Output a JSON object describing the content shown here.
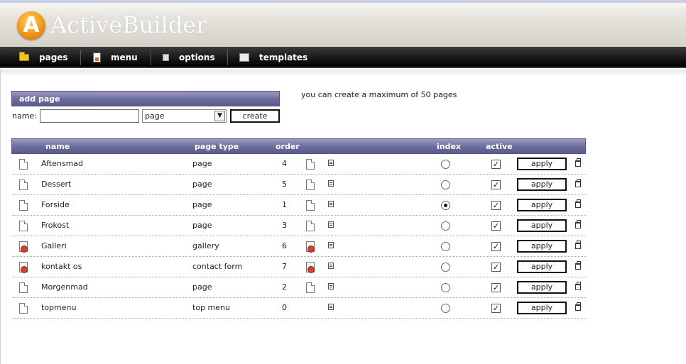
{
  "app": {
    "logo_letter": "A",
    "title": "ActiveBuilder"
  },
  "nav": [
    {
      "label": "pages",
      "icon": "folder-icon"
    },
    {
      "label": "menu",
      "icon": "menu-icon"
    },
    {
      "label": "options",
      "icon": "options-icon"
    },
    {
      "label": "templates",
      "icon": "templates-icon"
    }
  ],
  "add_page": {
    "title": "add page",
    "info": "you can create a maximum of 50 pages",
    "name_label": "name:",
    "name_value": "",
    "type_selected": "page",
    "create_label": "create"
  },
  "table": {
    "headers": {
      "name": "name",
      "page_type": "page type",
      "order": "order",
      "index": "index",
      "active": "active"
    },
    "apply_label": "apply",
    "rows": [
      {
        "name": "Aftensmad",
        "page_type": "page",
        "order": "4",
        "icon": "page-icon",
        "index": false,
        "active": true
      },
      {
        "name": "Dessert",
        "page_type": "page",
        "order": "5",
        "icon": "page-icon",
        "index": false,
        "active": true
      },
      {
        "name": "Forside",
        "page_type": "page",
        "order": "1",
        "icon": "page-icon",
        "index": true,
        "active": true
      },
      {
        "name": "Frokost",
        "page_type": "page",
        "order": "3",
        "icon": "page-icon",
        "index": false,
        "active": true
      },
      {
        "name": "Galleri",
        "page_type": "gallery",
        "order": "6",
        "icon": "special-page-icon",
        "index": false,
        "active": true
      },
      {
        "name": "kontakt os",
        "page_type": "contact form",
        "order": "7",
        "icon": "special-page-icon",
        "index": false,
        "active": true
      },
      {
        "name": "Morgenmad",
        "page_type": "page",
        "order": "2",
        "icon": "page-icon",
        "index": false,
        "active": true
      },
      {
        "name": "topmenu",
        "page_type": "top menu",
        "order": "0",
        "icon": "page-icon",
        "index": false,
        "active": true
      }
    ]
  }
}
